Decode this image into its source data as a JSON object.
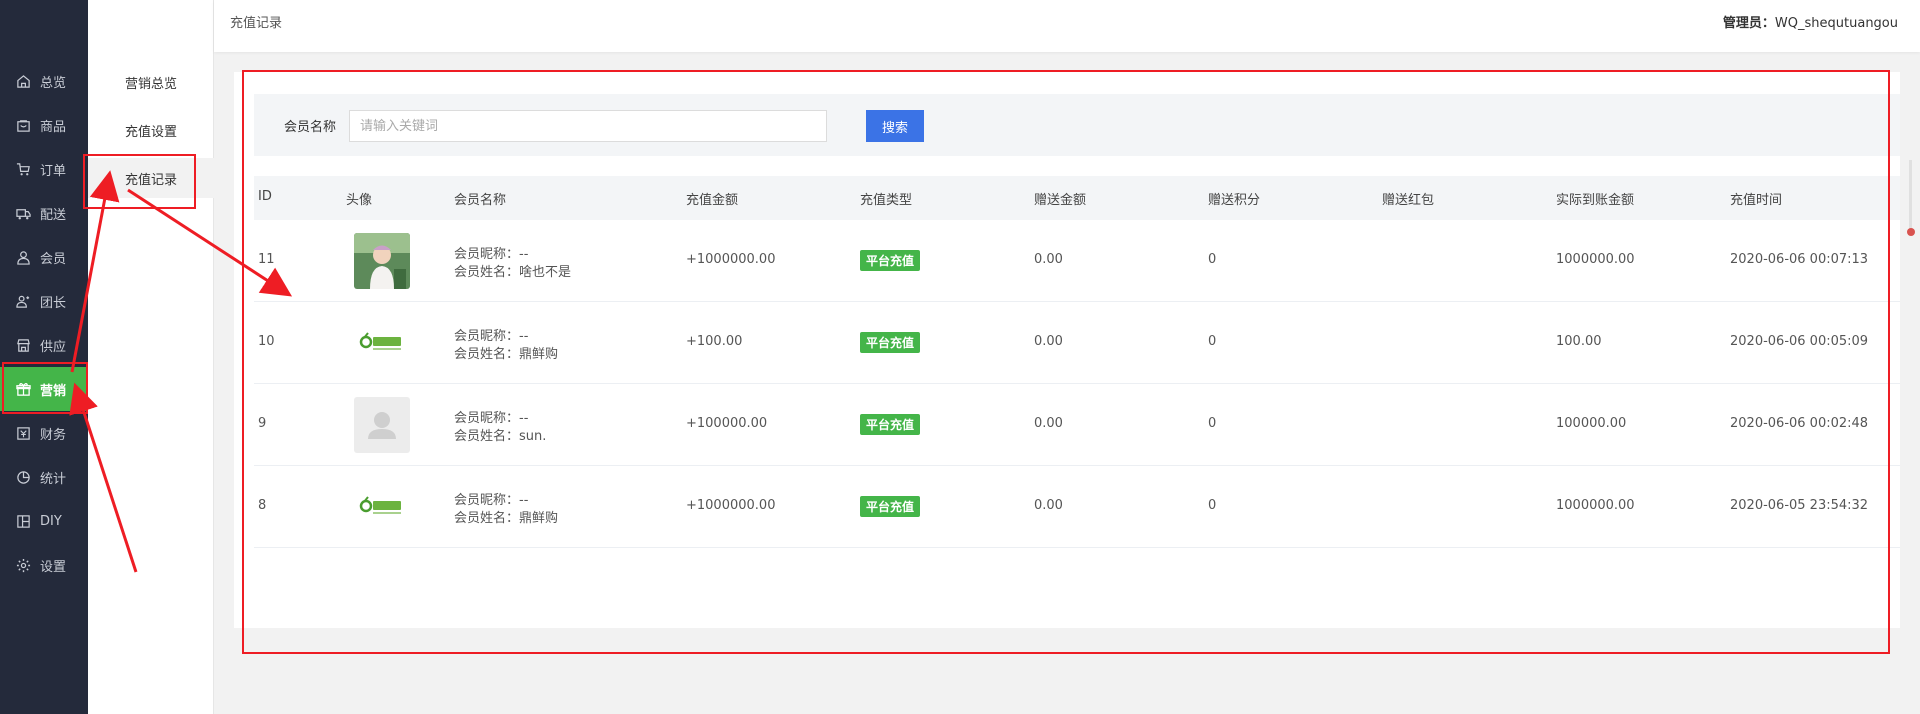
{
  "sidebar": {
    "items": [
      {
        "label": "总览",
        "icon": "home-icon"
      },
      {
        "label": "商品",
        "icon": "goods-icon"
      },
      {
        "label": "订单",
        "icon": "order-icon"
      },
      {
        "label": "配送",
        "icon": "delivery-icon"
      },
      {
        "label": "会员",
        "icon": "user-icon"
      },
      {
        "label": "团长",
        "icon": "leader-icon"
      },
      {
        "label": "供应",
        "icon": "supply-icon"
      },
      {
        "label": "营销",
        "icon": "gift-icon",
        "active": true
      },
      {
        "label": "财务",
        "icon": "finance-icon"
      },
      {
        "label": "统计",
        "icon": "pie-chart-icon"
      },
      {
        "label": "DIY",
        "icon": "layout-icon"
      },
      {
        "label": "设置",
        "icon": "gear-icon"
      }
    ]
  },
  "submenu": {
    "items": [
      {
        "label": "营销总览"
      },
      {
        "label": "充值设置"
      },
      {
        "label": "充值记录",
        "active": true
      }
    ]
  },
  "header": {
    "breadcrumb": "充值记录",
    "admin_label": "管理员：",
    "admin_name": "WQ_shequtuangou"
  },
  "search": {
    "label": "会员名称",
    "placeholder": "请输入关键词",
    "button": "搜索"
  },
  "table": {
    "columns": [
      "ID",
      "头像",
      "会员名称",
      "充值金额",
      "充值类型",
      "赠送金额",
      "赠送积分",
      "赠送红包",
      "实际到账金额",
      "充值时间"
    ],
    "rows": [
      {
        "id": "11",
        "avatar": "photo",
        "nickname": "会员昵称：--",
        "name": "会员姓名：啥也不是",
        "amount": "+1000000.00",
        "type": "平台充值",
        "gift_amount": "0.00",
        "gift_points": "0",
        "gift_redpack": "",
        "actual": "1000000.00",
        "time": "2020-06-06 00:07:13"
      },
      {
        "id": "10",
        "avatar": "logo",
        "nickname": "会员昵称：--",
        "name": "会员姓名：鼎鲜购",
        "amount": "+100.00",
        "type": "平台充值",
        "gift_amount": "0.00",
        "gift_points": "0",
        "gift_redpack": "",
        "actual": "100.00",
        "time": "2020-06-06 00:05:09"
      },
      {
        "id": "9",
        "avatar": "placeholder",
        "nickname": "会员昵称：--",
        "name": "会员姓名：sun.",
        "amount": "+100000.00",
        "type": "平台充值",
        "gift_amount": "0.00",
        "gift_points": "0",
        "gift_redpack": "",
        "actual": "100000.00",
        "time": "2020-06-06 00:02:48"
      },
      {
        "id": "8",
        "avatar": "logo",
        "nickname": "会员昵称：--",
        "name": "会员姓名：鼎鲜购",
        "amount": "+1000000.00",
        "type": "平台充值",
        "gift_amount": "0.00",
        "gift_points": "0",
        "gift_redpack": "",
        "actual": "1000000.00",
        "time": "2020-06-05 23:54:32"
      }
    ]
  },
  "colors": {
    "sidebar_bg": "#242a3b",
    "active_green": "#44b549",
    "search_button": "#3b73e6",
    "annotation_red": "#ee1d24"
  }
}
